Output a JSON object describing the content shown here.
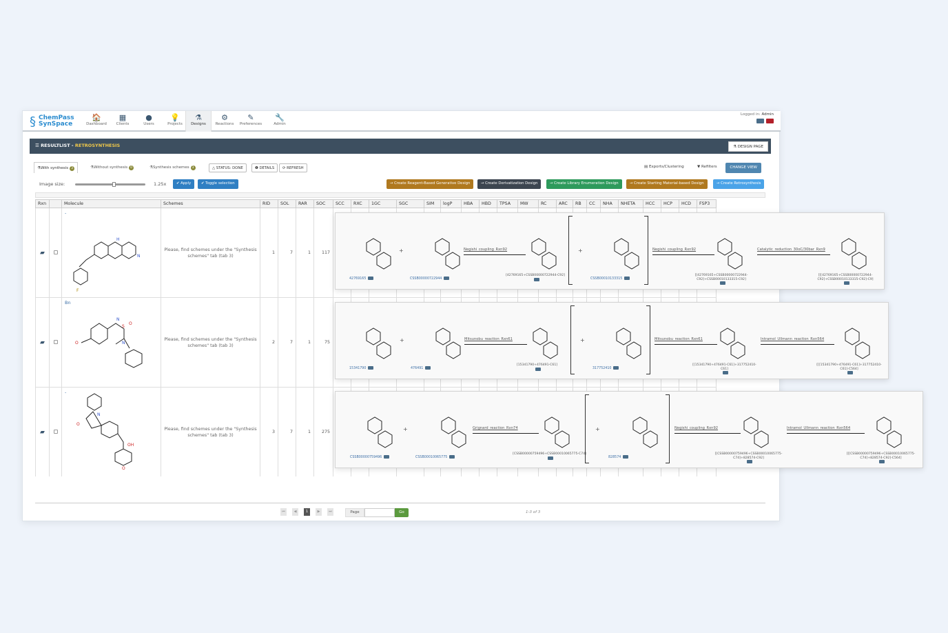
{
  "app": {
    "logo_line1": "ChemPass",
    "logo_line2": "SynSpace"
  },
  "nav": [
    {
      "label": "Dashboard",
      "icon": "home-icon",
      "glyph": "🏠"
    },
    {
      "label": "Clients",
      "icon": "building-icon",
      "glyph": "▦"
    },
    {
      "label": "Users",
      "icon": "user-icon",
      "glyph": "●"
    },
    {
      "label": "Projects",
      "icon": "lightbulb-icon",
      "glyph": "💡"
    },
    {
      "label": "Designs",
      "icon": "flask-icon",
      "glyph": "⚗"
    },
    {
      "label": "Reactions",
      "icon": "gear-icon",
      "glyph": "⚙"
    },
    {
      "label": "Preferences",
      "icon": "edit-icon",
      "glyph": "✎"
    },
    {
      "label": "Admin",
      "icon": "wrench-icon",
      "glyph": "🔧"
    }
  ],
  "login": {
    "prefix": "Logged in:",
    "user": "Admin"
  },
  "header": {
    "title_prefix": "RESULTLIST - ",
    "title_highlight": "RETROSYNTHESIS",
    "design_page": "DESIGN PAGE"
  },
  "tabs": [
    {
      "label": "With synthesis",
      "count": "3"
    },
    {
      "label": "Without synthesis",
      "count": "0"
    },
    {
      "label": "Synthesis schemes",
      "count": "3"
    }
  ],
  "pills": {
    "status": "STATUS: DONE",
    "details": "DETAILS",
    "refresh": "REFRESH"
  },
  "tools": {
    "exports": "Exports/Clustering",
    "refilters": "Refilters",
    "change_view": "CHANGE VIEW"
  },
  "sizebar": {
    "label": "Image size:",
    "zoom": "1.25x",
    "apply": "Apply",
    "toggle": "Toggle selection"
  },
  "design_buttons": [
    {
      "label": "→ Create Reagent-Based Generative Design",
      "color": "#b0791f"
    },
    {
      "label": "→ Create Derivatization Design",
      "color": "#3c4550"
    },
    {
      "label": "→ Create Library Enumeration Design",
      "color": "#2e9a5c"
    },
    {
      "label": "→ Create Starting Material-based Design",
      "color": "#b0791f"
    },
    {
      "label": "→ Create Retrosynthesis",
      "color": "#4aa3e8"
    }
  ],
  "columns": [
    "Rxn",
    "",
    "Molecule",
    "Schemes",
    "RID",
    "SOL",
    "RAR",
    "SOC",
    "SCC",
    "RXC",
    "1GC",
    "SGC",
    "SIM",
    "logP",
    "HBA",
    "HBD",
    "TPSA",
    "MW",
    "RC",
    "ARC",
    "RB",
    "CC",
    "NHA",
    "NHETA",
    "HCC",
    "HCP",
    "HCD",
    "FSP3"
  ],
  "rows": [
    {
      "label": "-",
      "schemes": "Please, find schemes under the \"Synthesis schemes\" tab (tab 3)",
      "rid": "1",
      "sol": "7",
      "rar": "1",
      "soc": "117"
    },
    {
      "label": "Bn",
      "schemes": "Please, find schemes under the \"Synthesis schemes\" tab (tab 3)",
      "rid": "2",
      "sol": "7",
      "rar": "1",
      "soc": "75"
    },
    {
      "label": "-",
      "schemes": "Please, find schemes under the \"Synthesis schemes\" tab (tab 3)",
      "rid": "3",
      "sol": "7",
      "rar": "1",
      "soc": "275"
    }
  ],
  "schemes": [
    {
      "ids": [
        "42769165",
        "CSSB00000722944",
        "CSSB00010133315"
      ],
      "rxns": [
        "Negishi_coupling_Rxn92",
        "Negishi_coupling_Rxn92",
        "Catalytic_reduction_30oC/30bar_Rxn9"
      ],
      "prods": [
        "[42769165+CSSB00000722944-C92]",
        "[[42769165+CSSB00000722944-C92]+CSSB00010133315-C92]",
        "[[[42769165+CSSB00000722944-C92]+CSSB00010133315-C92]-C9]"
      ]
    },
    {
      "ids": [
        "15341790",
        "476491",
        "317752410"
      ],
      "rxns": [
        "Mitsunobu_reaction_Rxn61",
        "Mitsunobu_reaction_Rxn61",
        "Intramol_Ullmann_reaction_Rxn564"
      ],
      "prods": [
        "[15341790+476491-C61]",
        "[[15341790+476491-C61]+317752410-C61]",
        "[[[15341790+476491-C61]+317752410-C61]-C564]"
      ]
    },
    {
      "ids": [
        "CSSB00000759496",
        "CSSB00010065775",
        "828574"
      ],
      "rxns": [
        "Grignard_reaction_Rxn74",
        "Negishi_coupling_Rxn92",
        "Intramol_Ullmann_reaction_Rxn564"
      ],
      "prods": [
        "[CSSB00000759496+CSSB00010065775-C74]",
        "[[CSSB00000759496+CSSB00010065775-C74]+828574-C92]",
        "[[[CSSB00000759496+CSSB00010065775-C74]+828574-C92]-C564]"
      ]
    }
  ],
  "pager": {
    "page": "1",
    "page_label": "Page",
    "go": "Go",
    "of": "1-3 of 3"
  }
}
